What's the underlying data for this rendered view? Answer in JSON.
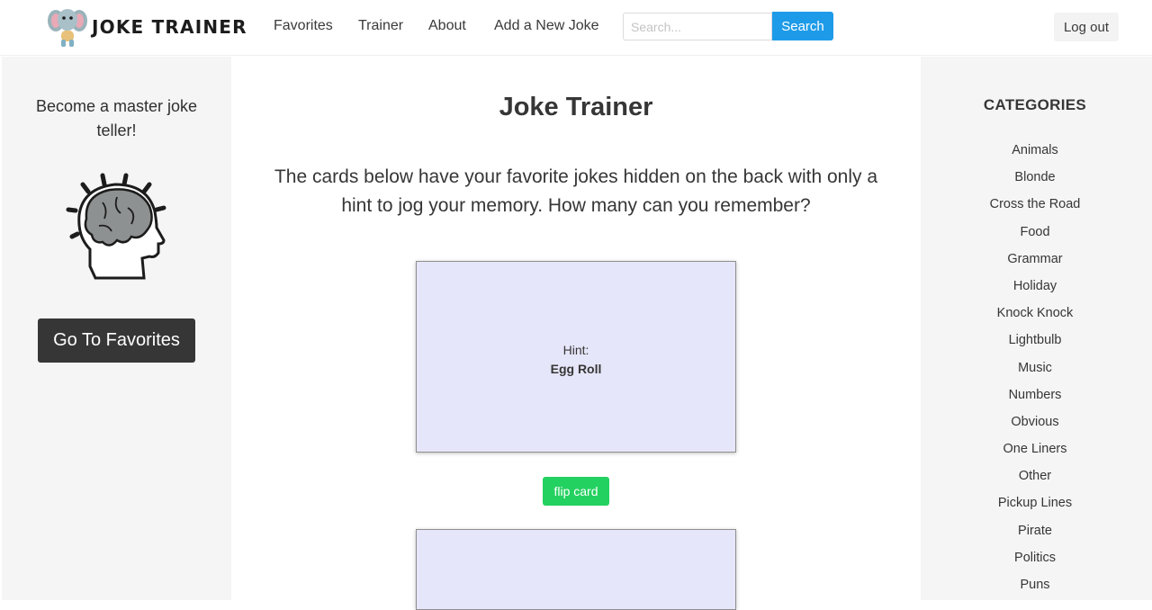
{
  "header": {
    "brand": "JOKE TRAINER",
    "nav": [
      {
        "label": "Favorites"
      },
      {
        "label": "Trainer"
      },
      {
        "label": "About"
      },
      {
        "label": "Add a New Joke"
      }
    ],
    "search_placeholder": "Search...",
    "search_label": "Search",
    "logout_label": "Log out"
  },
  "sidebar_left": {
    "tagline": "Become a master joke teller!",
    "favorites_button": "Go To Favorites"
  },
  "main": {
    "title": "Joke Trainer",
    "intro": "The cards below have your favorite jokes hidden on the back with only a hint to jog your memory. How many can you remember?",
    "cards": [
      {
        "hint_label": "Hint:",
        "hint": "Egg Roll"
      }
    ],
    "flip_label": "flip card"
  },
  "sidebar_right": {
    "heading": "CATEGORIES",
    "categories": [
      "Animals",
      "Blonde",
      "Cross the Road",
      "Food",
      "Grammar",
      "Holiday",
      "Knock Knock",
      "Lightbulb",
      "Music",
      "Numbers",
      "Obvious",
      "One Liners",
      "Other",
      "Pickup Lines",
      "Pirate",
      "Politics",
      "Puns"
    ]
  },
  "colors": {
    "search_button": "#1e9be8",
    "flip_button": "#23d160",
    "card_background": "#e6e6fa",
    "favorites_button": "#363636"
  },
  "icons": {
    "brand": "elephant-logo-icon",
    "left_illustration": "brain-head-icon"
  }
}
